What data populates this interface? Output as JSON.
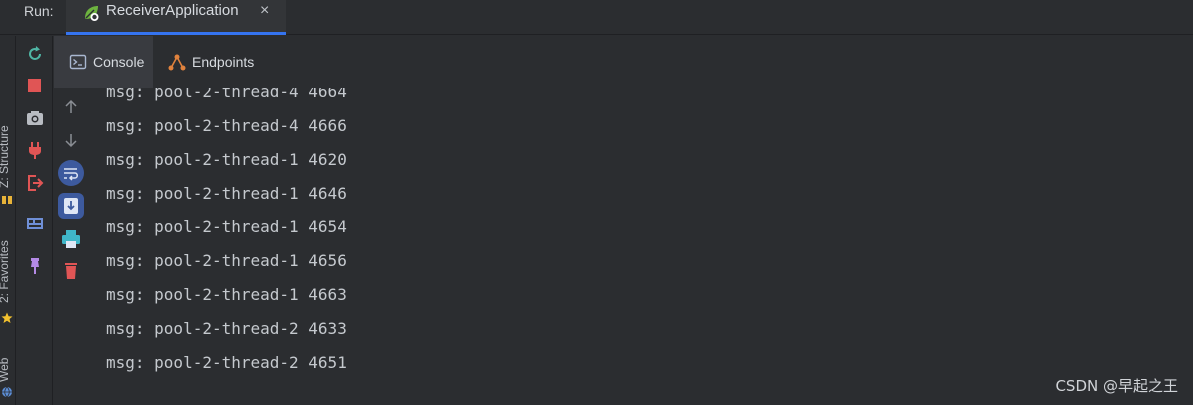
{
  "run_bar": {
    "label": "Run:",
    "tab": {
      "title": "ReceiverApplication",
      "close": "×",
      "icon": "spring-leaf-icon"
    }
  },
  "side_tabs": [
    {
      "label": "Z: Structure",
      "icon": "structure-icon"
    },
    {
      "label": "2: Favorites",
      "icon": "star-icon"
    },
    {
      "label": "Web",
      "icon": "web-icon"
    }
  ],
  "tool_buttons_primary": [
    {
      "icon": "rerun-icon",
      "color": "#4fb6a5"
    },
    {
      "icon": "stop-icon",
      "color": "#e05555"
    },
    {
      "icon": "camera-icon",
      "color": "#b8bcc2"
    },
    {
      "icon": "plug-icon",
      "color": "#e05555"
    },
    {
      "icon": "exit-icon",
      "color": "#e05555"
    },
    {
      "icon": "layout-icon",
      "color": "#6f8fd6"
    },
    {
      "icon": "pin-icon",
      "color": "#b48ae6"
    }
  ],
  "tool_buttons_secondary": [
    {
      "icon": "arrow-up-icon"
    },
    {
      "icon": "arrow-down-icon"
    },
    {
      "icon": "soft-wrap-icon"
    },
    {
      "icon": "scroll-to-end-icon"
    },
    {
      "icon": "print-icon"
    },
    {
      "icon": "trash-icon"
    }
  ],
  "sub_tabs": [
    {
      "label": "Console",
      "icon": "console-icon",
      "active": true
    },
    {
      "label": "Endpoints",
      "icon": "endpoints-icon",
      "active": false
    }
  ],
  "console": {
    "lines": [
      "msg: pool-2-thread-4 4664",
      "msg: pool-2-thread-4 4666",
      "msg: pool-2-thread-1 4620",
      "msg: pool-2-thread-1 4646",
      "msg: pool-2-thread-1 4654",
      "msg: pool-2-thread-1 4656",
      "msg: pool-2-thread-1 4663",
      "msg: pool-2-thread-2 4633",
      "msg: pool-2-thread-2 4651"
    ]
  },
  "watermark": "CSDN @早起之王",
  "colors": {
    "background": "#2b2d30",
    "accent": "#3574f0",
    "text": "#c5c9ce"
  }
}
